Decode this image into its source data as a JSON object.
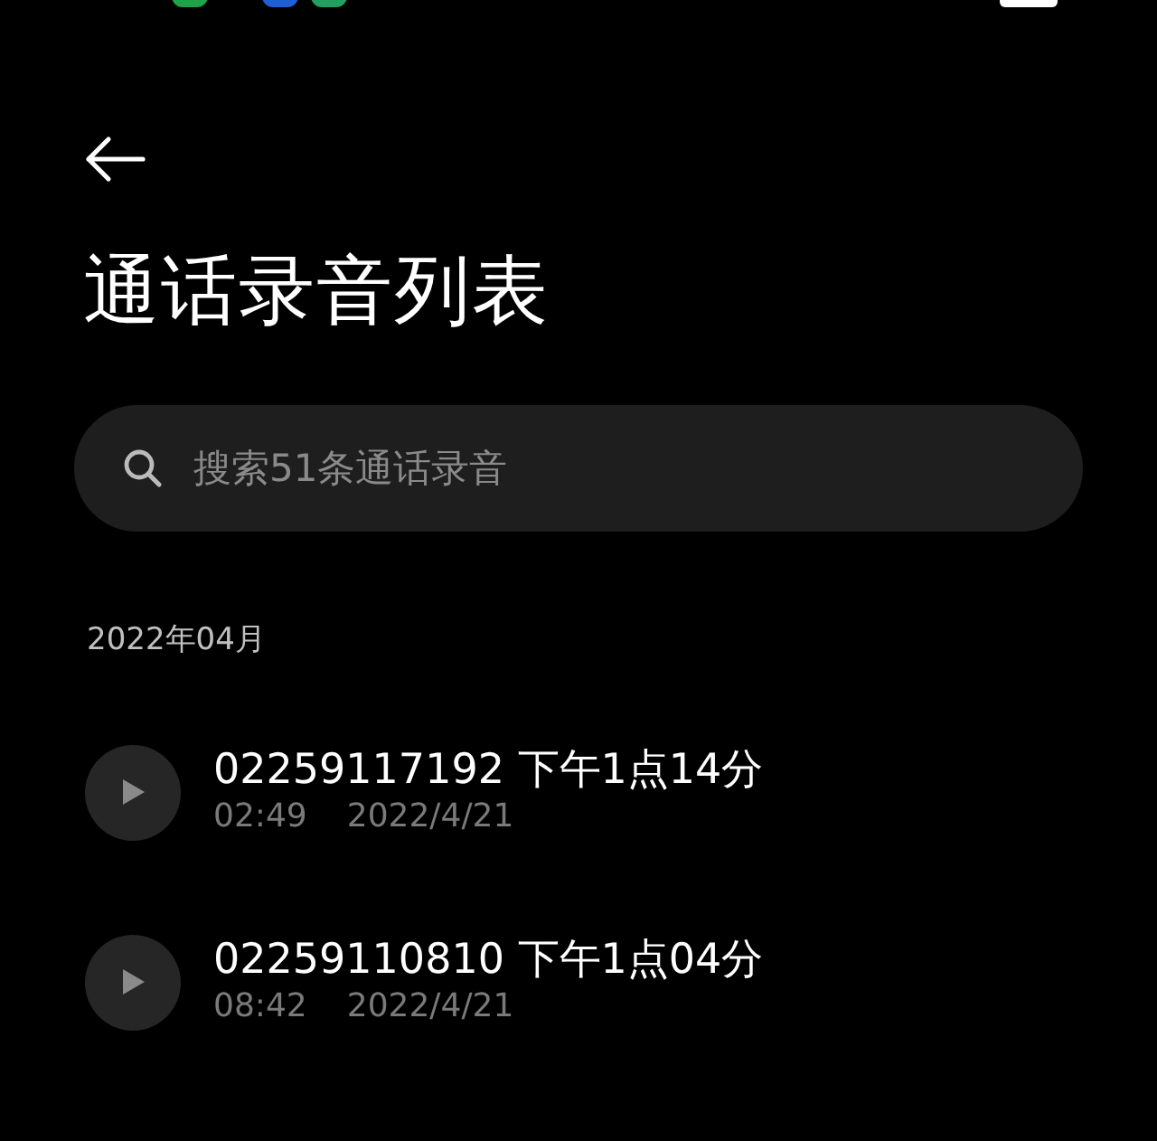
{
  "header": {
    "title": "通话录音列表"
  },
  "search": {
    "placeholder": "搜索51条通话录音"
  },
  "sections": [
    {
      "label": "2022年04月",
      "recordings": [
        {
          "title": "02259117192 下午1点14分",
          "duration": "02:49",
          "date": "2022/4/21"
        },
        {
          "title": "02259110810 下午1点04分",
          "duration": "08:42",
          "date": "2022/4/21"
        }
      ]
    }
  ]
}
